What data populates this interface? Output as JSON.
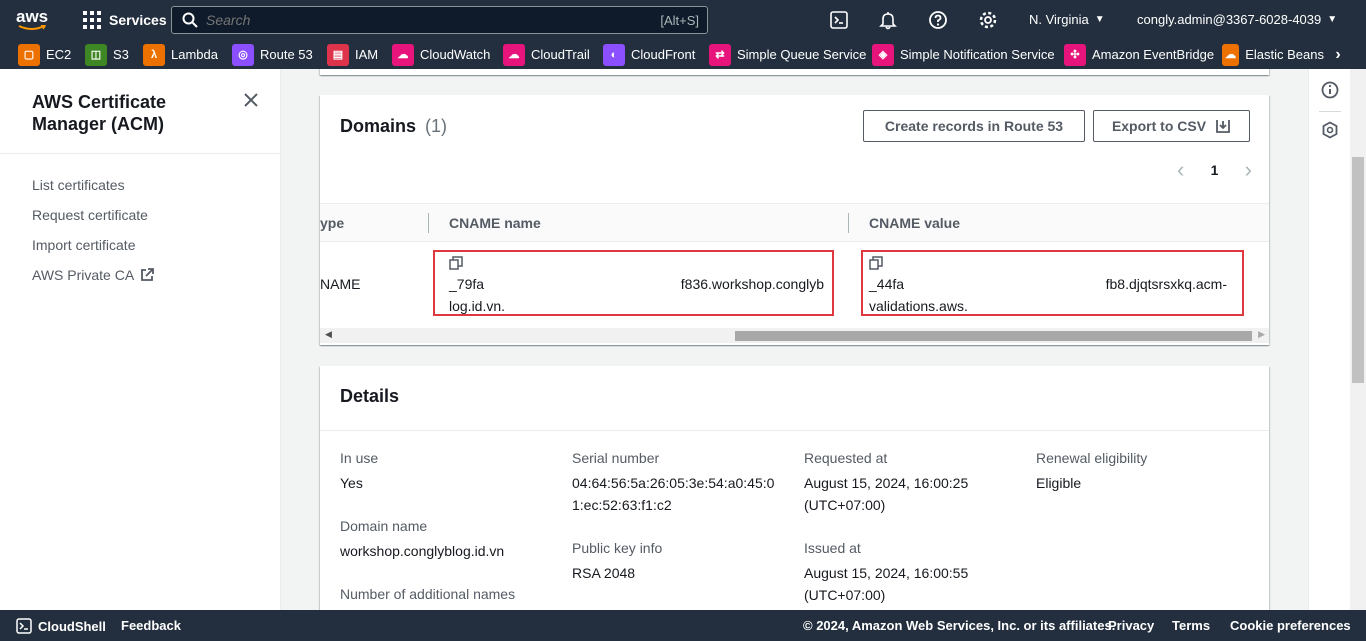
{
  "topnav": {
    "logo": "aws",
    "services": "Services",
    "search_placeholder": "Search",
    "search_shortcut": "[Alt+S]",
    "region": "N. Virginia",
    "account": "congly.admin@3367-6028-4039"
  },
  "favorites": [
    {
      "label": "EC2",
      "color": "#ed7100"
    },
    {
      "label": "S3",
      "color": "#3f8624"
    },
    {
      "label": "Lambda",
      "color": "#ed7100"
    },
    {
      "label": "Route 53",
      "color": "#8c4fff"
    },
    {
      "label": "IAM",
      "color": "#dd344c"
    },
    {
      "label": "CloudWatch",
      "color": "#e7157b"
    },
    {
      "label": "CloudTrail",
      "color": "#e7157b"
    },
    {
      "label": "CloudFront",
      "color": "#8c4fff"
    },
    {
      "label": "Simple Queue Service",
      "color": "#e7157b"
    },
    {
      "label": "Simple Notification Service",
      "color": "#e7157b"
    },
    {
      "label": "Amazon EventBridge",
      "color": "#e7157b"
    },
    {
      "label": "Elastic Beans",
      "color": "#ed7100"
    }
  ],
  "sidebar": {
    "title_line1": "AWS Certificate",
    "title_line2": "Manager (ACM)",
    "items": [
      "List certificates",
      "Request certificate",
      "Import certificate",
      "AWS Private CA"
    ]
  },
  "domains": {
    "title": "Domains",
    "count": "(1)",
    "create_records_label": "Create records in Route 53",
    "export_label": "Export to CSV",
    "page": "1",
    "columns": [
      "ype",
      "CNAME name",
      "CNAME value"
    ],
    "row": {
      "type": "NAME",
      "cname_name_start": "_79fa",
      "cname_name_end": "f836.workshop.conglyb",
      "cname_name_line2": "log.id.vn.",
      "cname_value_start": "_44fa",
      "cname_value_end": "fb8.djqtsrsxkq.acm-",
      "cname_value_line2": "validations.aws."
    }
  },
  "details": {
    "title": "Details",
    "in_use_label": "In use",
    "in_use_value": "Yes",
    "domain_name_label": "Domain name",
    "domain_name_value": "workshop.conglyblog.id.vn",
    "additional_names_label": "Number of additional names",
    "serial_label": "Serial number",
    "serial_line1": "04:64:56:5a:26:05:3e:54:a0:45:0",
    "serial_line2": "1:ec:52:63:f1:c2",
    "public_key_label": "Public key info",
    "public_key_value": "RSA 2048",
    "requested_label": "Requested at",
    "requested_line1": "August 15, 2024, 16:00:25",
    "requested_line2": "(UTC+07:00)",
    "issued_label": "Issued at",
    "issued_line1": "August 15, 2024, 16:00:55",
    "issued_line2": "(UTC+07:00)",
    "renewal_label": "Renewal eligibility",
    "renewal_value": "Eligible"
  },
  "footer": {
    "cloudshell": "CloudShell",
    "feedback": "Feedback",
    "copyright": "© 2024, Amazon Web Services, Inc. or its affiliates.",
    "privacy": "Privacy",
    "terms": "Terms",
    "cookies": "Cookie preferences"
  }
}
